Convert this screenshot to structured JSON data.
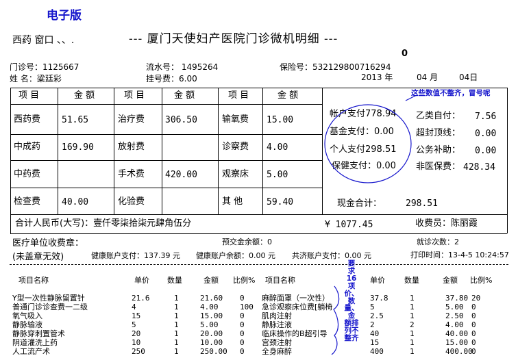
{
  "doc": {
    "label": "电子版",
    "dept": "西药 窗口 、、.",
    "title": "--- 厦门天使妇产医院门诊微机明细 ---",
    "zero": "0",
    "clinic_no": "门诊号：1125667",
    "serial_no": "流水号： 1495264",
    "insurance_no": "保险号：532129800716294",
    "name_line": "姓  名：粱廷彩",
    "reg_fee": "挂号费：6.00",
    "date_year": "2013 年",
    "date_month": "04 月",
    "date_day": "04日"
  },
  "fee_table": {
    "headers": [
      "项 目",
      "金 额",
      "项 目",
      "金 额",
      "项 目",
      "金 额"
    ],
    "rows": [
      [
        {
          "name": "西药费",
          "amount": "51.65"
        },
        {
          "name": "治疗费",
          "amount": "306.50"
        },
        {
          "name": "输氧费",
          "amount": "15.00"
        }
      ],
      [
        {
          "name": "中成药",
          "amount": "169.90"
        },
        {
          "name": "放射费",
          "amount": ""
        },
        {
          "name": "诊察费",
          "amount": "4.00"
        }
      ],
      [
        {
          "name": "中药费",
          "amount": ""
        },
        {
          "name": "手术费",
          "amount": "420.00"
        },
        {
          "name": "观察床",
          "amount": "5.00"
        }
      ],
      [
        {
          "name": "检查费",
          "amount": "40.00"
        },
        {
          "name": "化验费",
          "amount": ""
        },
        {
          "name": "其  他",
          "amount": "59.40"
        }
      ]
    ],
    "payments_left": [
      "帐户支付778.94",
      "基金支付：0.00",
      "个人支付298.51",
      "保健支付：0.00"
    ],
    "payments_right": [
      {
        "label": "乙类自付：",
        "value": "7.56"
      },
      {
        "label": "超封顶线：",
        "value": "0.00"
      },
      {
        "label": "公务补助：",
        "value": "0.00"
      },
      {
        "label": "非医保费：",
        "value": "428.34"
      }
    ],
    "cash_label": "现金合计：",
    "cash_value": "298.51",
    "total_label": "合计人民币(大写)：壹仟零柒拾柒元肆角伍分",
    "total_value": "¥ 1077.45",
    "cashier": "收费员：陈丽霞"
  },
  "footer": {
    "seal": "医疗单位收费章：",
    "deposit": "预交金余额：0",
    "visits": "就诊次数：2",
    "no_seal": "(未盖章无效)",
    "health_paid": "健康账户支付：137.39 元",
    "health_balance": "健康账户余额：0.00 元",
    "mutual_paid": "共济账户支付：0.00 元",
    "print_time": "打印时间：13-4-5 10:24:57"
  },
  "detail": {
    "headers_left": [
      "项目名称",
      "单价",
      "数量",
      "金额",
      "比例%"
    ],
    "headers_right": [
      "项目名称",
      "单价",
      "数量",
      "金额",
      "比例%"
    ],
    "left": [
      [
        "Y型一次性静脉留置针",
        "21.6",
        "1",
        "21.60",
        "0"
      ],
      [
        "普通门诊诊查费一二级",
        "4",
        "1",
        "4.00",
        "100"
      ],
      [
        "氧气吸入",
        "15",
        "1",
        "15.00",
        "0"
      ],
      [
        "静脉输液",
        "5",
        "1",
        "5.00",
        "0"
      ],
      [
        "静脉穿刺置管术",
        "20",
        "1",
        "20.00",
        "0"
      ],
      [
        "阴道灌洗上药",
        "10",
        "1",
        "10.00",
        "0"
      ],
      [
        "人工流产术",
        "250",
        "1",
        "250.00",
        "0"
      ]
    ],
    "right": [
      [
        "麻醉面罩（一次性）",
        "37.8",
        "1",
        "37.80",
        "20"
      ],
      [
        "急诊观察床位费[躺椅",
        "5",
        "1",
        "5.00",
        "0"
      ],
      [
        "肌肉注射",
        "2.5",
        "1",
        "2.50",
        "0"
      ],
      [
        "静脉注液",
        "2",
        "2",
        "4.00",
        "0"
      ],
      [
        "临床操作的B超引导",
        "40",
        "1",
        "40.00",
        "0"
      ],
      [
        "宫颈注射",
        "15",
        "1",
        "15.00",
        "0"
      ],
      [
        "全身麻醉",
        "400",
        "1",
        "400.00",
        "0"
      ]
    ]
  },
  "annotations": {
    "top_note": "这些数值不整齐，冒号呢",
    "side_note": [
      "要",
      "求",
      "16",
      "项",
      "价、",
      "数量、",
      "金",
      "额排",
      "列不",
      "整齐"
    ],
    "accent": "#1515cc"
  }
}
